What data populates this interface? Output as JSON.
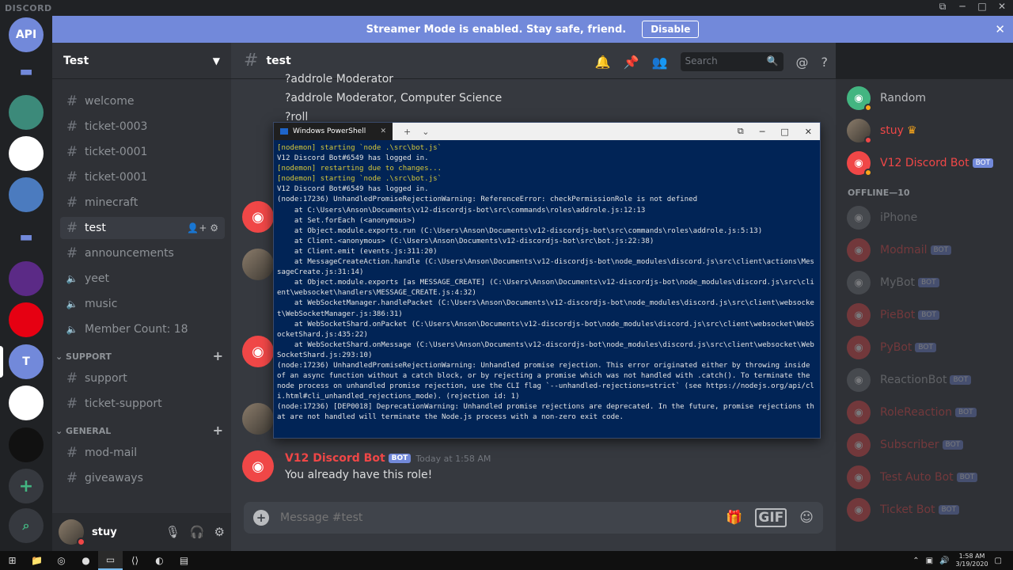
{
  "app": {
    "brand": "DISCORD"
  },
  "streamer": {
    "message": "Streamer Mode is enabled. Stay safe, friend.",
    "disable_label": "Disable"
  },
  "guilds": [
    {
      "name": "API",
      "color": "#7289da"
    },
    {
      "name": "",
      "color": "folder"
    },
    {
      "name": "",
      "color": "#3c8a7a"
    },
    {
      "name": "",
      "color": "#ffffff"
    },
    {
      "name": "",
      "color": "#4b7bbf"
    },
    {
      "name": "",
      "color": "folder"
    },
    {
      "name": "",
      "color": "#5b2a86"
    },
    {
      "name": "",
      "color": "#e60012"
    },
    {
      "name": "T",
      "color": "#7289da"
    },
    {
      "name": "",
      "color": "#ffffff"
    },
    {
      "name": "",
      "color": "#111111"
    }
  ],
  "server": {
    "name": "Test"
  },
  "channels": [
    {
      "type": "text",
      "name": "welcome"
    },
    {
      "type": "text",
      "name": "ticket-0003"
    },
    {
      "type": "text",
      "name": "ticket-0001"
    },
    {
      "type": "text",
      "name": "ticket-0001"
    },
    {
      "type": "text",
      "name": "minecraft"
    },
    {
      "type": "text",
      "name": "test",
      "active": true
    },
    {
      "type": "text",
      "name": "announcements"
    },
    {
      "type": "voice",
      "name": "yeet"
    },
    {
      "type": "voice",
      "name": "music"
    },
    {
      "type": "voice",
      "name": "Member Count: 18"
    }
  ],
  "categories": {
    "support": {
      "label": "SUPPORT",
      "channels": [
        "support",
        "ticket-support"
      ]
    },
    "general": {
      "label": "GENERAL",
      "channels": [
        "mod-mail",
        "giveaways"
      ]
    }
  },
  "user": {
    "name": "stuy"
  },
  "chat": {
    "channel_name": "test",
    "search_placeholder": "Search",
    "lines": [
      "?addrole Moderator",
      "?addrole Moderator, Computer Science",
      "?roll"
    ],
    "last_message": {
      "author": "V12 Discord Bot",
      "tag": "BOT",
      "timestamp": "Today at 1:58 AM",
      "text": "You already have this role!"
    },
    "composer_placeholder": "Message #test",
    "gif_label": "GIF"
  },
  "members": {
    "online": [
      {
        "name": "Random",
        "color": "#b9bbbe",
        "bot": false
      },
      {
        "name": "stuy",
        "color": "#f04747",
        "bot": false,
        "crown": true
      },
      {
        "name": "V12 Discord Bot",
        "color": "#f04747",
        "bot": true
      }
    ],
    "offline_label": "OFFLINE—10",
    "offline": [
      {
        "name": "iPhone",
        "color": "#b9bbbe",
        "bot": false
      },
      {
        "name": "Modmail",
        "color": "#f04747",
        "bot": true
      },
      {
        "name": "MyBot",
        "color": "#b9bbbe",
        "bot": true
      },
      {
        "name": "PieBot",
        "color": "#f04747",
        "bot": true
      },
      {
        "name": "PyBot",
        "color": "#f04747",
        "bot": true
      },
      {
        "name": "ReactionBot",
        "color": "#b9bbbe",
        "bot": true
      },
      {
        "name": "RoleReaction",
        "color": "#f04747",
        "bot": true
      },
      {
        "name": "Subscriber",
        "color": "#f04747",
        "bot": true
      },
      {
        "name": "Test Auto Bot",
        "color": "#f04747",
        "bot": true
      },
      {
        "name": "Ticket Bot",
        "color": "#f04747",
        "bot": true
      }
    ],
    "bot_tag": "BOT"
  },
  "powershell": {
    "tab_title": "Windows PowerShell",
    "lines": [
      {
        "t": "[nodemon] starting `node .\\src\\bot.js`",
        "nd": true
      },
      {
        "t": "V12 Discord Bot#6549 has logged in.",
        "nd": false
      },
      {
        "t": "[nodemon] restarting due to changes...",
        "nd": true
      },
      {
        "t": "[nodemon] starting `node .\\src\\bot.js`",
        "nd": true
      },
      {
        "t": "V12 Discord Bot#6549 has logged in.",
        "nd": false
      },
      {
        "t": "(node:17236) UnhandledPromiseRejectionWarning: ReferenceError: checkPermissionRole is not defined",
        "nd": false
      },
      {
        "t": "    at C:\\Users\\Anson\\Documents\\v12-discordjs-bot\\src\\commands\\roles\\addrole.js:12:13",
        "nd": false
      },
      {
        "t": "    at Set.forEach (<anonymous>)",
        "nd": false
      },
      {
        "t": "    at Object.module.exports.run (C:\\Users\\Anson\\Documents\\v12-discordjs-bot\\src\\commands\\roles\\addrole.js:5:13)",
        "nd": false
      },
      {
        "t": "    at Client.<anonymous> (C:\\Users\\Anson\\Documents\\v12-discordjs-bot\\src\\bot.js:22:38)",
        "nd": false
      },
      {
        "t": "    at Client.emit (events.js:311:20)",
        "nd": false
      },
      {
        "t": "    at MessageCreateAction.handle (C:\\Users\\Anson\\Documents\\v12-discordjs-bot\\node_modules\\discord.js\\src\\client\\actions\\MessageCreate.js:31:14)",
        "nd": false
      },
      {
        "t": "    at Object.module.exports [as MESSAGE_CREATE] (C:\\Users\\Anson\\Documents\\v12-discordjs-bot\\node_modules\\discord.js\\src\\client\\websocket\\handlers\\MESSAGE_CREATE.js:4:32)",
        "nd": false
      },
      {
        "t": "    at WebSocketManager.handlePacket (C:\\Users\\Anson\\Documents\\v12-discordjs-bot\\node_modules\\discord.js\\src\\client\\websocket\\WebSocketManager.js:386:31)",
        "nd": false
      },
      {
        "t": "    at WebSocketShard.onPacket (C:\\Users\\Anson\\Documents\\v12-discordjs-bot\\node_modules\\discord.js\\src\\client\\websocket\\WebSocketShard.js:435:22)",
        "nd": false
      },
      {
        "t": "    at WebSocketShard.onMessage (C:\\Users\\Anson\\Documents\\v12-discordjs-bot\\node_modules\\discord.js\\src\\client\\websocket\\WebSocketShard.js:293:10)",
        "nd": false
      },
      {
        "t": "(node:17236) UnhandledPromiseRejectionWarning: Unhandled promise rejection. This error originated either by throwing inside of an async function without a catch block, or by rejecting a promise which was not handled with .catch(). To terminate the node process on unhandled promise rejection, use the CLI flag `--unhandled-rejections=strict` (see https://nodejs.org/api/cli.html#cli_unhandled_rejections_mode). (rejection id: 1)",
        "nd": false
      },
      {
        "t": "(node:17236) [DEP0018] DeprecationWarning: Unhandled promise rejections are deprecated. In the future, promise rejections that are not handled will terminate the Node.js process with a non-zero exit code.",
        "nd": false
      }
    ]
  },
  "taskbar": {
    "time": "1:58 AM",
    "date": "3/19/2020"
  },
  "colors": {
    "blurple": "#7289da",
    "dnd": "#f04747",
    "online": "#43b581",
    "ps_bg": "#012456"
  }
}
